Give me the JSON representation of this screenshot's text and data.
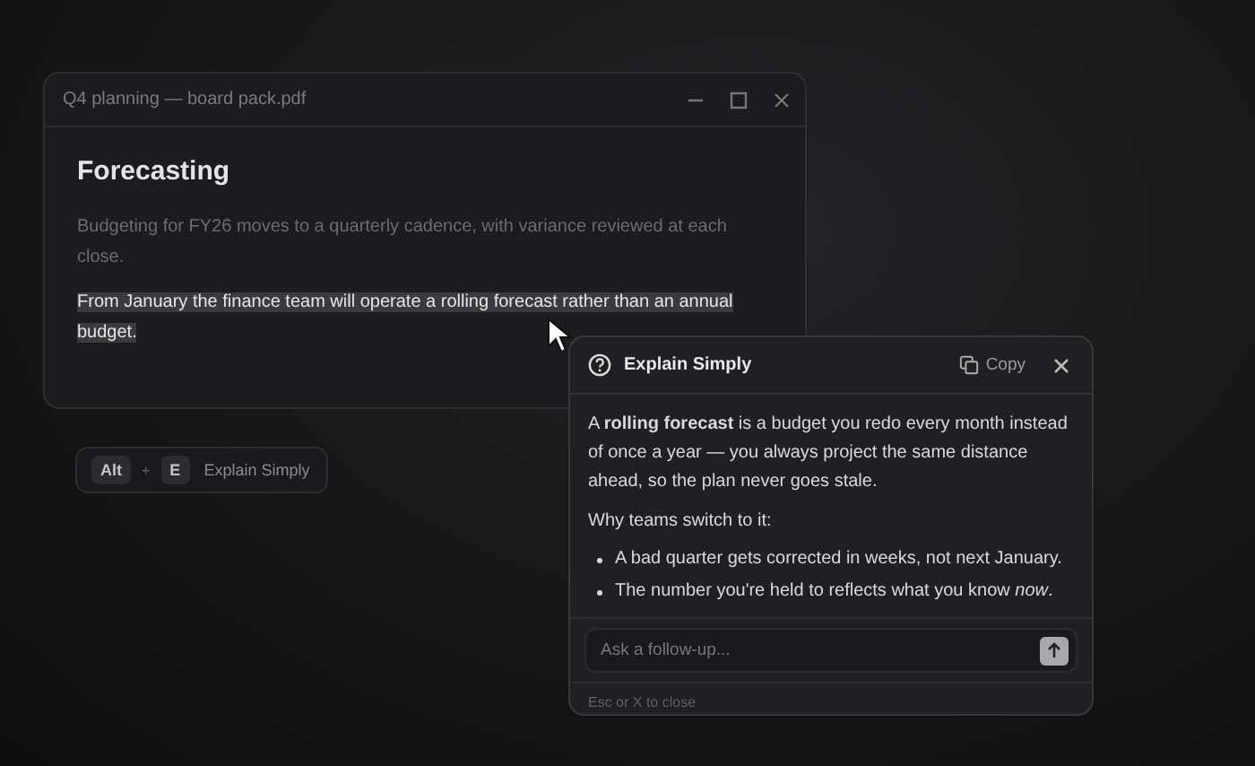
{
  "document_window": {
    "title": "Q4 planning — board pack.pdf",
    "heading": "Forecasting",
    "paragraphs": [
      {
        "text": "Budgeting for FY26 moves to a quarterly cadence, with variance reviewed at each close.",
        "selected": false
      },
      {
        "text": "From January the finance team will operate a rolling forecast rather than an annual budget.",
        "selected": true
      }
    ]
  },
  "shortcut_hint": {
    "keys": [
      "Alt",
      "E"
    ],
    "joiner": "+",
    "label": "Explain Simply"
  },
  "explain_popup": {
    "title": "Explain Simply",
    "copy_label": "Copy",
    "definition": "A **rolling forecast** is a budget you redo every month instead of once a year — you always project the same distance ahead, so the plan never goes stale.",
    "subheading": "Why teams switch to it:",
    "bullets": [
      "A bad quarter gets corrected in weeks, not next January.",
      "The number you're held to reflects what you know *now*."
    ],
    "follow_up": {
      "placeholder": "Ask a follow-up..."
    },
    "footer": "Esc or X to close"
  }
}
